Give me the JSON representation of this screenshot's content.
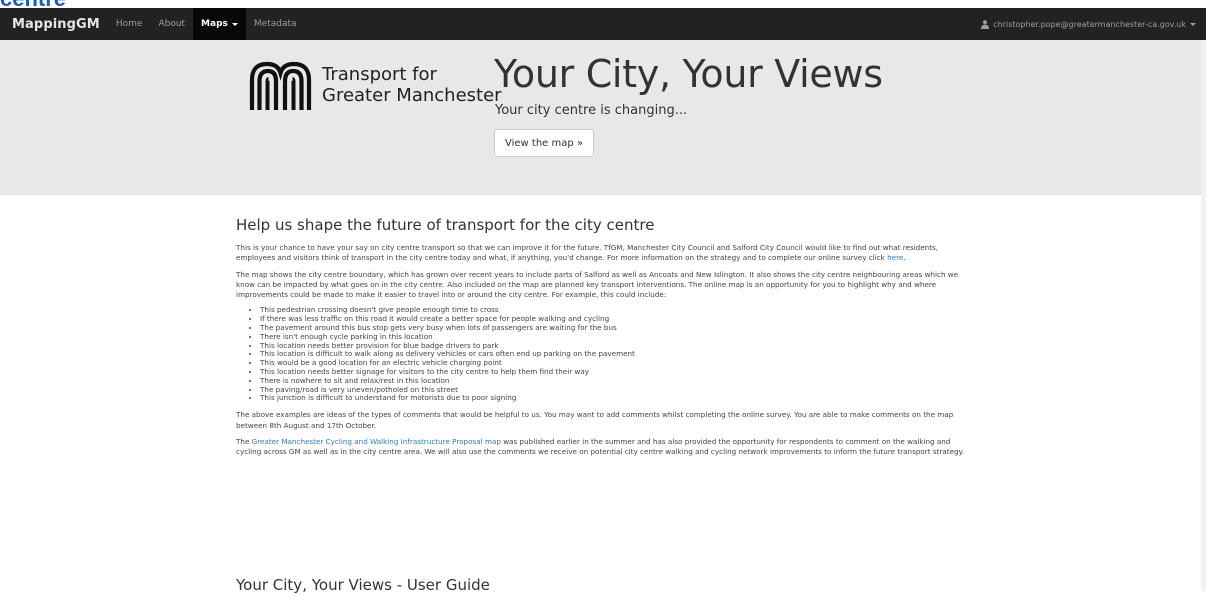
{
  "page_top_heading": "centre",
  "navbar": {
    "brand": "MappingGM",
    "items": [
      {
        "label": "Home",
        "active": false
      },
      {
        "label": "About",
        "active": false
      },
      {
        "label": "Maps",
        "active": true,
        "dropdown": true
      },
      {
        "label": "Metadata",
        "active": false
      }
    ],
    "user_email": "christopher.pope@greatermanchester-ca.gov.uk"
  },
  "hero": {
    "org_line1": "Transport for",
    "org_line2": "Greater Manchester",
    "title": "Your City, Your Views",
    "subtitle": "Your city centre is changing...",
    "button_label": "View the map »"
  },
  "main": {
    "heading": "Help us shape the future of transport for the city centre",
    "para1_text": "This is your chance to have your say on city centre transport so that we can improve it for the future. TfGM, Manchester City Council and Salford City Council would like to find out what residents, employees and visitors think of transport in the city centre today and what, if anything, you'd change. For more information on the strategy and to complete our online survey click ",
    "para1_link": "here",
    "para1_end": ".",
    "para2": "The map shows the city centre boundary, which has grown over recent years to include parts of Salford as well as Ancoats and New Islington. It also shows the city centre neighbouring areas which we know can be impacted by what goes on in the city centre. Also included on the map are planned key transport interventions. The online map is an opportunity for you to highlight why and where improvements could be made to make it easier to travel into or around the city centre. For example, this could include:",
    "bullets": [
      "This pedestrian crossing doesn't give people enough time to cross",
      "If there was less traffic on this road it would create a better space for people walking and cycling",
      "The pavement around this bus stop gets very busy when lots of passengers are waiting for the bus",
      "There isn't enough cycle parking in this location",
      "This location needs better provision for blue badge drivers to park",
      "This location is difficult to walk along as delivery vehicles or cars often end up parking on the pavement",
      "This would be a good location for an electric vehicle charging point",
      "This location needs better signage for visitors to the city centre to help them find their way",
      "There is nowhere to sit and relax/rest in this location",
      "The paving/road is very uneven/potholed on this street",
      "This junction is difficult to understand for motorists due to poor signing"
    ],
    "para3": "The above examples are ideas of the types of comments that would be helpful to us. You may want to add comments whilst completing the online survey. You are able to make comments on the map between 8th August and 17th October.",
    "para4_start": "The ",
    "para4_link": "Greater Manchester Cycling and Walking Infrastructure Proposal map",
    "para4_end": " was published earlier in the summer and has also provided the opportunity for respondents to comment on the walking and cycling across GM as well as in the city centre area. We will also use the comments we receive on potential city centre walking and cycling network improvements to inform the future transport strategy.",
    "guide_heading": "Your City, Your Views - User Guide"
  },
  "colors": {
    "navbar_bg": "#222222",
    "jumbotron_bg": "#e8e8e8",
    "link": "#337ab7"
  }
}
